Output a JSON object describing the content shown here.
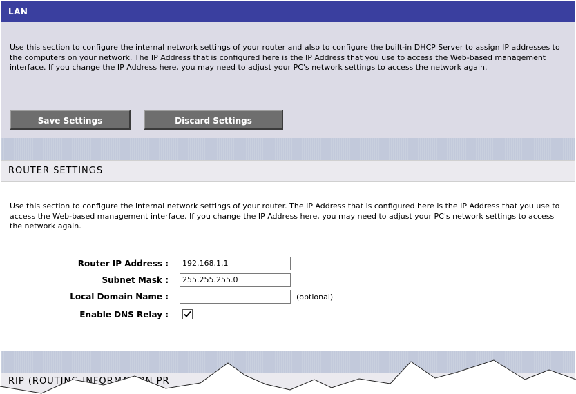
{
  "lan": {
    "title": "LAN",
    "description": "Use this section to configure the internal network settings of your router and also to configure the built-in DHCP Server to assign IP addresses to the computers on your network. The IP Address that is configured here is the IP Address that you use to access the Web-based management interface. If you change the IP Address here, you may need to adjust your PC's network settings to access the network again.",
    "save_label": "Save Settings",
    "discard_label": "Discard Settings"
  },
  "router": {
    "title": "ROUTER SETTINGS",
    "description": "Use this section to configure the internal network settings of your router. The IP Address that is configured here is the IP Address that you use to access the Web-based management interface. If you change the IP Address here, you may need to adjust your PC's network settings to access the network again.",
    "ip_label": "Router IP Address :",
    "ip_value": "192.168.1.1",
    "mask_label": "Subnet Mask :",
    "mask_value": "255.255.255.0",
    "domain_label": "Local Domain Name :",
    "domain_value": "",
    "domain_hint": "(optional)",
    "dns_label": "Enable DNS Relay :",
    "dns_checked": true
  },
  "rip": {
    "title": "RIP (ROUTING INFORMATION PR"
  },
  "colors": {
    "title_bar": "#3a3f9f",
    "lan_bg": "#dcdbe6",
    "button": "#6e6e6e",
    "divider": "#c2c9db"
  }
}
